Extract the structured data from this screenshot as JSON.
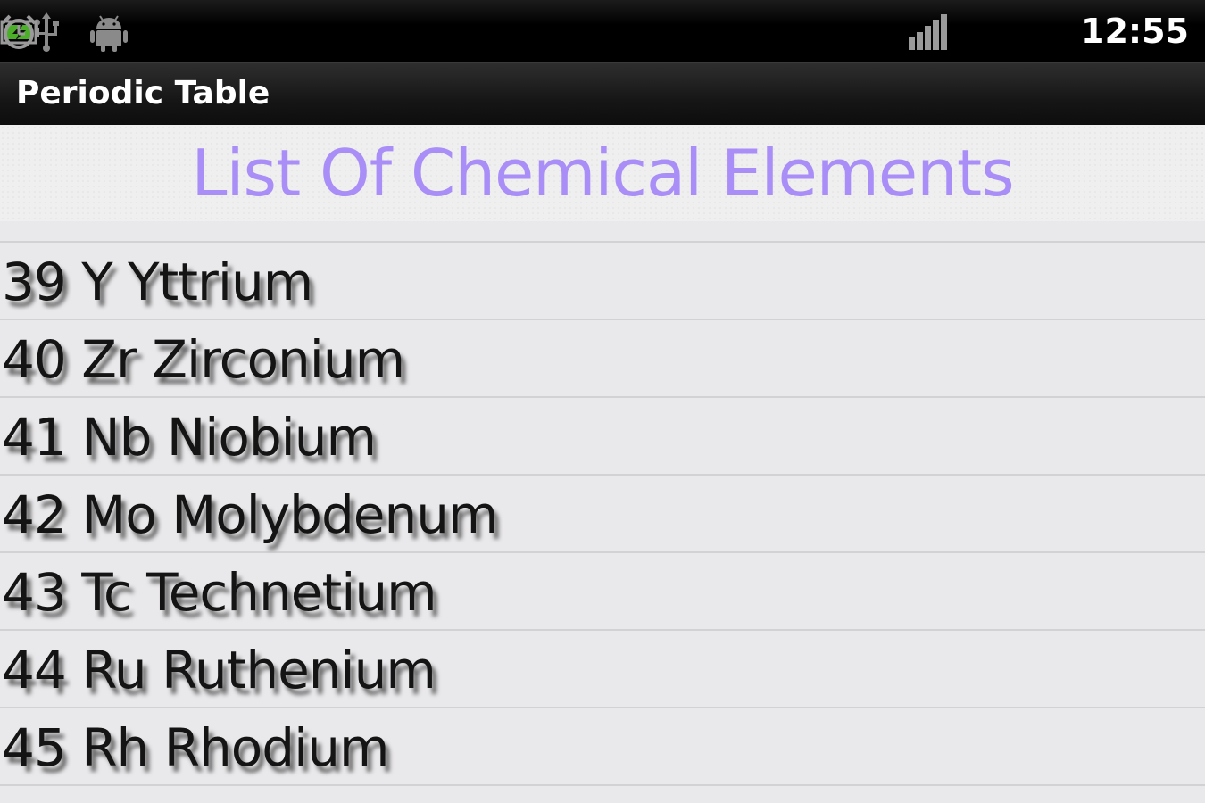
{
  "status_bar": {
    "icons": [
      "usb-icon",
      "android-icon",
      "signal-icon",
      "battery-charging-icon",
      "alarm-clock-icon"
    ],
    "time": "12:55"
  },
  "app": {
    "title": "Periodic Table"
  },
  "header": {
    "heading": "List Of Chemical Elements",
    "heading_color": "#a98ef7"
  },
  "elements": [
    {
      "text": "39 Y Yttrium"
    },
    {
      "text": "40 Zr Zirconium"
    },
    {
      "text": "41 Nb Niobium"
    },
    {
      "text": "42 Mo Molybdenum"
    },
    {
      "text": "43 Tc Technetium"
    },
    {
      "text": "44 Ru Ruthenium"
    },
    {
      "text": "45 Rh Rhodium"
    }
  ]
}
